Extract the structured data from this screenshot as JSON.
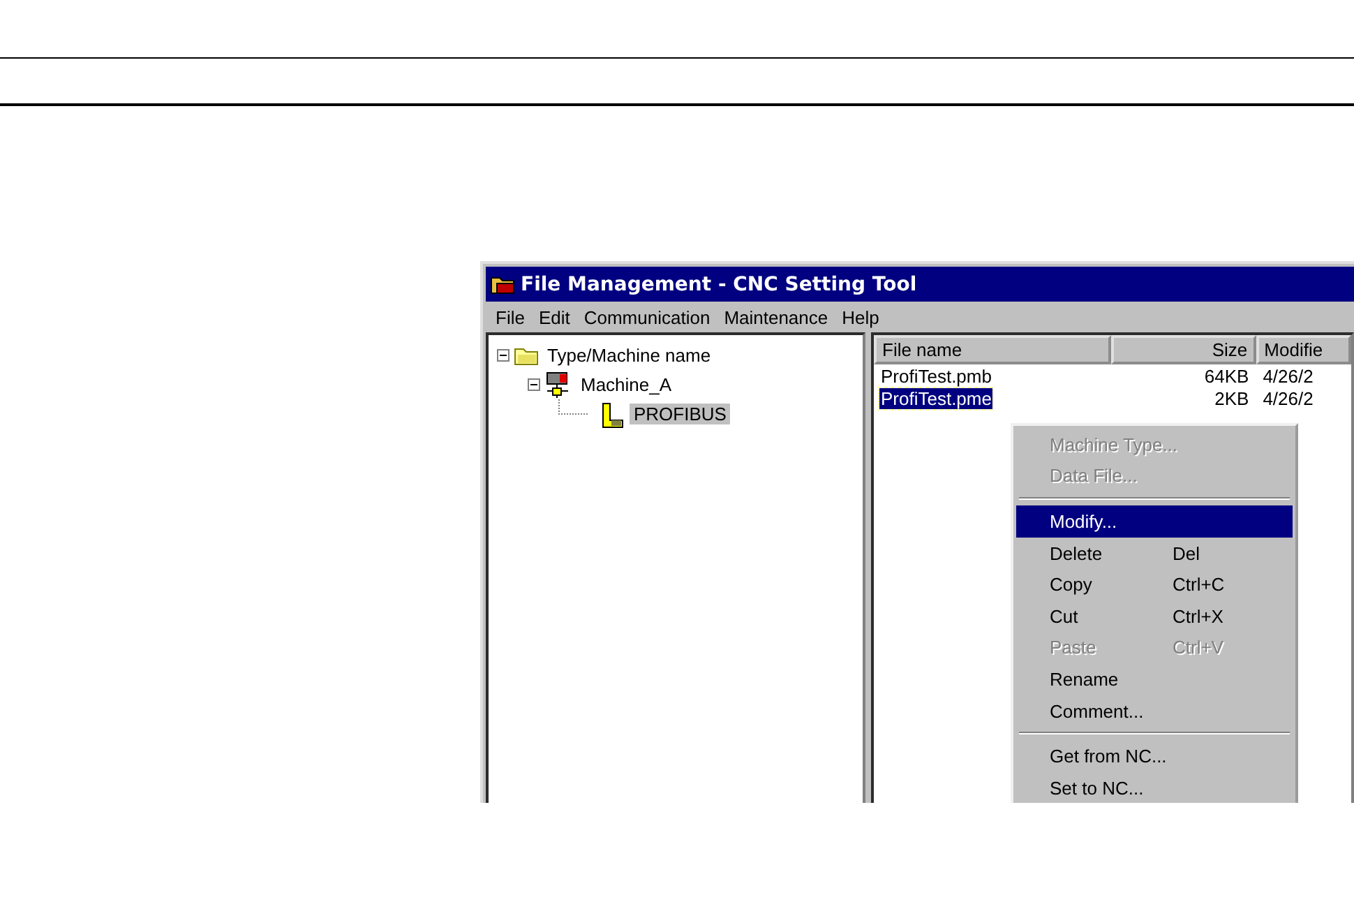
{
  "window": {
    "title": "File Management - CNC Setting Tool"
  },
  "menu_bar": [
    {
      "label": "File"
    },
    {
      "label": "Edit"
    },
    {
      "label": "Communication"
    },
    {
      "label": "Maintenance"
    },
    {
      "label": "Help"
    }
  ],
  "tree": [
    {
      "label": "Type/Machine name",
      "kind": "folder",
      "expanded": true,
      "selected": false,
      "children": [
        {
          "label": "Machine_A",
          "kind": "machine",
          "expanded": true,
          "selected": false,
          "children": [
            {
              "label": "PROFIBUS",
              "kind": "bus",
              "selected": true
            }
          ]
        }
      ]
    }
  ],
  "file_list": {
    "columns": [
      {
        "label": "File name"
      },
      {
        "label": "Size"
      },
      {
        "label": "Modifie"
      }
    ],
    "rows": [
      {
        "cells": [
          "ProfiTest.pmb",
          "64KB",
          "4/26/2"
        ],
        "selected": false
      },
      {
        "cells": [
          "ProfiTest.pme",
          "2KB",
          "4/26/2"
        ],
        "selected": true
      }
    ]
  },
  "context_menu": [
    {
      "kind": "item",
      "label": "Machine Type...",
      "disabled": true,
      "selected": false
    },
    {
      "kind": "item",
      "label": "Data File...",
      "disabled": true,
      "selected": false
    },
    {
      "kind": "separator"
    },
    {
      "kind": "item",
      "label": "Modify...",
      "disabled": false,
      "selected": true
    },
    {
      "kind": "item",
      "label": "Delete",
      "shortcut": "Del",
      "disabled": false,
      "selected": false
    },
    {
      "kind": "item",
      "label": "Copy",
      "shortcut": "Ctrl+C",
      "disabled": false,
      "selected": false
    },
    {
      "kind": "item",
      "label": "Cut",
      "shortcut": "Ctrl+X",
      "disabled": false,
      "selected": false
    },
    {
      "kind": "item",
      "label": "Paste",
      "shortcut": "Ctrl+V",
      "disabled": true,
      "selected": false
    },
    {
      "kind": "item",
      "label": "Rename",
      "disabled": false,
      "selected": false
    },
    {
      "kind": "item",
      "label": "Comment...",
      "disabled": false,
      "selected": false
    },
    {
      "kind": "separator"
    },
    {
      "kind": "item",
      "label": "Get from NC...",
      "disabled": false,
      "selected": false
    },
    {
      "kind": "item",
      "label": "Set to NC...",
      "disabled": false,
      "selected": false
    }
  ]
}
